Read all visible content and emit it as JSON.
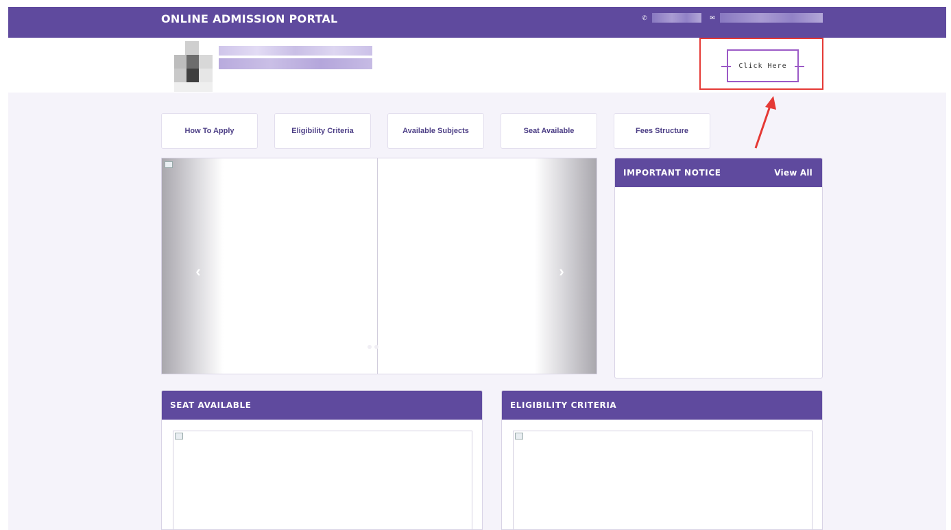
{
  "header": {
    "portal_title": "ONLINE ADMISSION PORTAL",
    "phone_icon": "phone-icon",
    "email_icon": "envelope-icon"
  },
  "cta": {
    "label": "Click Here"
  },
  "nav_buttons": [
    "How To Apply",
    "Eligibility Criteria",
    "Available Subjects",
    "Seat Available",
    "Fees Structure"
  ],
  "notice": {
    "title": "IMPORTANT NOTICE",
    "view_all": "View All"
  },
  "panels": {
    "seat": {
      "title": "SEAT AVAILABLE"
    },
    "eligibility": {
      "title": "ELIGIBILITY CRITERIA"
    }
  },
  "slider": {
    "prev_glyph": "‹",
    "next_glyph": "›"
  },
  "colors": {
    "brand": "#5f4a9e",
    "annotation": "#e53935",
    "cta_border": "#9b59c6"
  }
}
